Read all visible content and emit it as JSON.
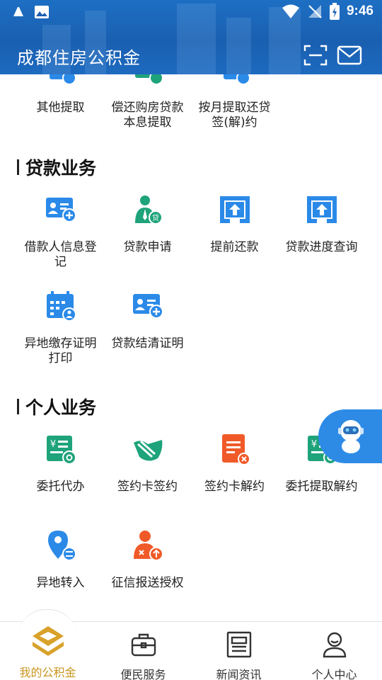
{
  "status_bar": {
    "time": "9:46"
  },
  "header": {
    "title": "成都住房公积金"
  },
  "top_row": {
    "items": [
      {
        "label": "其他提取"
      },
      {
        "label": "偿还购房贷款本息提取"
      },
      {
        "label": "按月提取还贷签(解)约"
      }
    ]
  },
  "loan_section": {
    "title": "贷款业务",
    "items": [
      {
        "label": "借款人信息登记"
      },
      {
        "label": "贷款申请"
      },
      {
        "label": "提前还款"
      },
      {
        "label": "贷款进度查询"
      },
      {
        "label": "异地缴存证明打印"
      },
      {
        "label": "贷款结清证明"
      }
    ]
  },
  "personal_section": {
    "title": "个人业务",
    "items": [
      {
        "label": "委托代办"
      },
      {
        "label": "签约卡签约"
      },
      {
        "label": "签约卡解约"
      },
      {
        "label": "委托提取解约"
      },
      {
        "label": "异地转入"
      },
      {
        "label": "征信报送授权"
      }
    ]
  },
  "bottom_nav": {
    "items": [
      {
        "label": "我的公积金"
      },
      {
        "label": "便民服务"
      },
      {
        "label": "新闻资讯"
      },
      {
        "label": "个人中心"
      }
    ]
  },
  "colors": {
    "header_blue": "#1a5fb0",
    "icon_blue": "#2b8ae8",
    "icon_green": "#1ea37a",
    "icon_orange": "#f05a28",
    "active_gold": "#c9961f"
  }
}
